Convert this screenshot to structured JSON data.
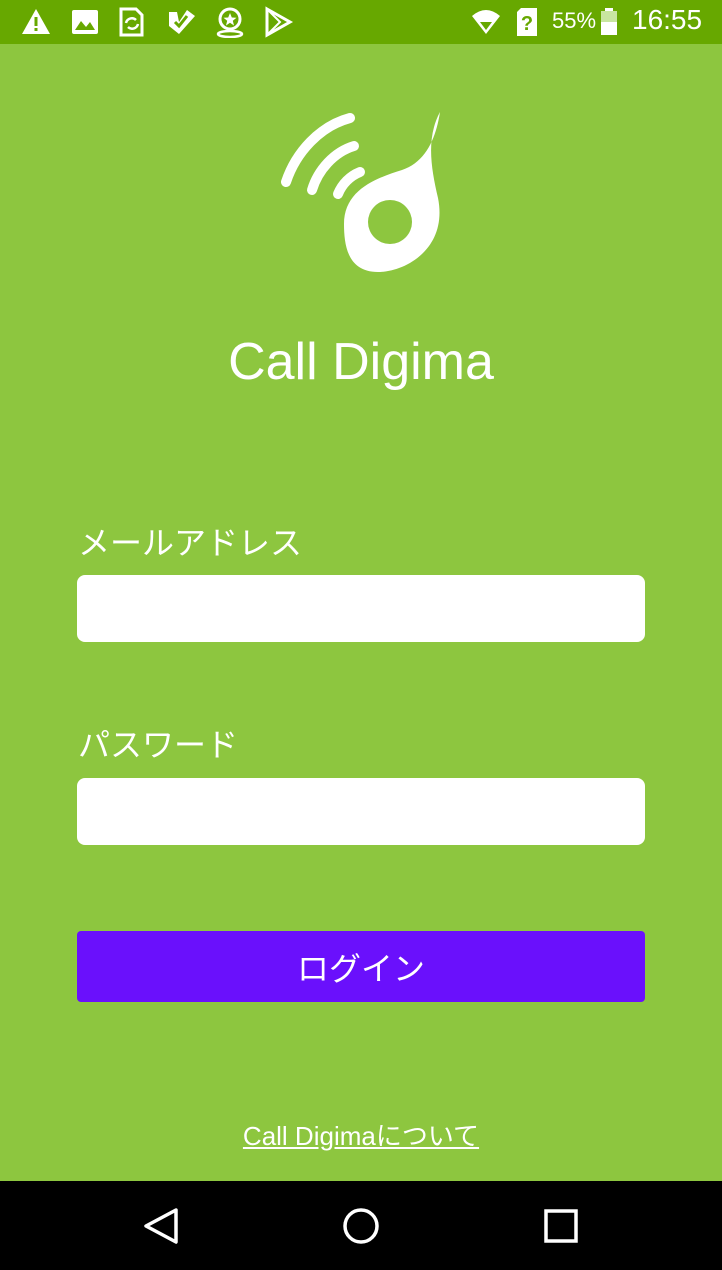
{
  "status_bar": {
    "icons": [
      "warning-icon",
      "image-icon",
      "sync-icon",
      "check-icon",
      "location-star-icon",
      "play-store-icon"
    ],
    "wifi_icon": "wifi-icon",
    "sim_icon": "sim-unknown-icon",
    "battery_percent": "55%",
    "battery_level": 0.55,
    "time": "16:55"
  },
  "app": {
    "logo_icon": "call-digima-logo-icon",
    "title": "Call Digima"
  },
  "form": {
    "email_label": "メールアドレス",
    "email_value": "",
    "password_label": "パスワード",
    "password_value": "",
    "login_button": "ログイン"
  },
  "footer": {
    "about_link": "Call Digimaについて"
  },
  "nav_bar": {
    "back_icon": "back-triangle-icon",
    "home_icon": "home-circle-icon",
    "recents_icon": "recents-square-icon"
  },
  "colors": {
    "background": "#8dc63f",
    "status_bar": "#67a800",
    "button": "#6a10fc",
    "text": "#ffffff",
    "nav_bar": "#000000"
  }
}
